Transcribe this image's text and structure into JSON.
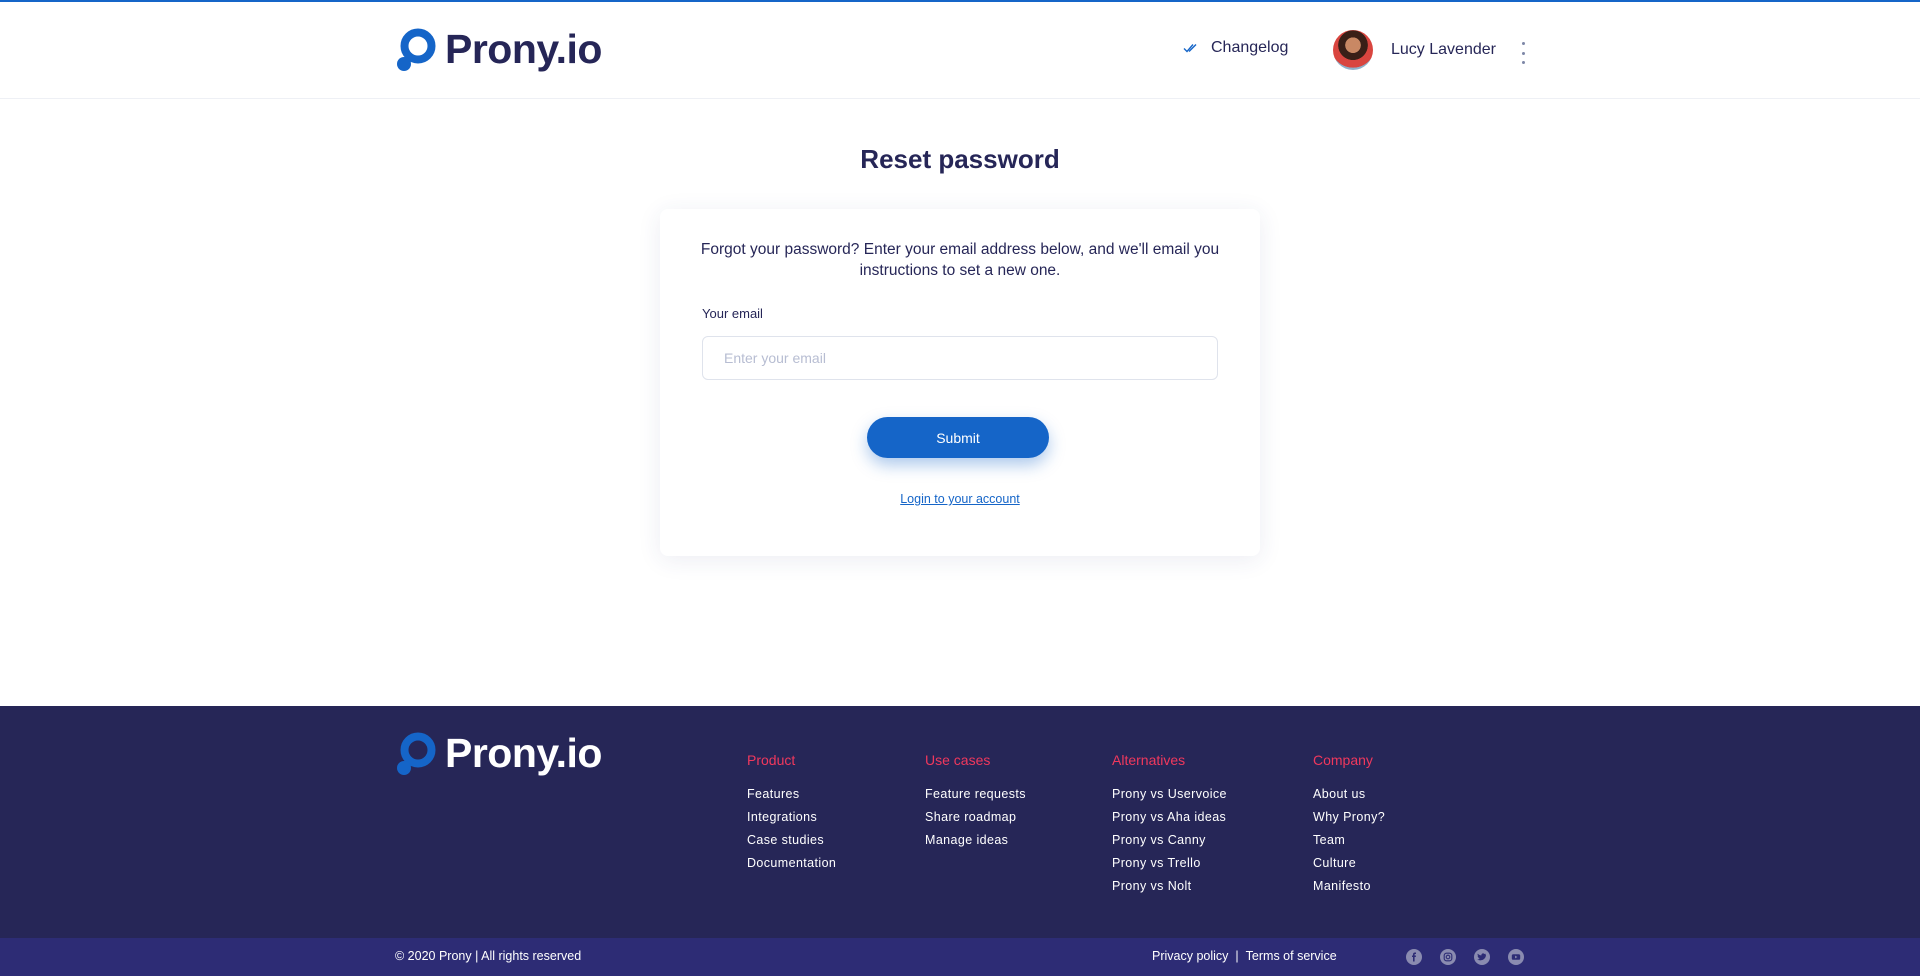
{
  "colors": {
    "primary": "#1565c8",
    "navy": "#262657",
    "footer_bg": "#262657",
    "bottom_bar_bg": "#2d2c75",
    "accent_red": "#f0385d"
  },
  "header": {
    "logo_text": "Prony.io",
    "changelog_label": "Changelog",
    "changelog_icon": "double-check-icon",
    "user_name": "Lucy Lavender",
    "menu_icon": "kebab-menu-icon"
  },
  "main": {
    "title": "Reset password",
    "intro": "Forgot your password? Enter your email address below, and we'll email you instructions to set a new one.",
    "email_label": "Your email",
    "email_placeholder": "Enter your email",
    "email_value": "",
    "submit_label": "Submit",
    "login_link": "Login to your account"
  },
  "footer": {
    "logo_text": "Prony.io",
    "columns": [
      {
        "heading": "Product",
        "links": [
          "Features",
          "Integrations",
          "Case studies",
          "Documentation"
        ]
      },
      {
        "heading": "Use cases",
        "links": [
          "Feature requests",
          "Share roadmap",
          "Manage ideas"
        ]
      },
      {
        "heading": "Alternatives",
        "links": [
          "Prony vs Uservoice",
          "Prony vs Aha ideas",
          "Prony vs Canny",
          "Prony vs Trello",
          "Prony vs Nolt"
        ]
      },
      {
        "heading": "Company",
        "links": [
          "About us",
          "Why Prony?",
          "Team",
          "Culture",
          "Manifesto"
        ]
      }
    ],
    "copyright": "© 2020 Prony  |  All rights reserved",
    "privacy": "Privacy policy",
    "separator": "|",
    "terms": "Terms of service",
    "socials": [
      "facebook-icon",
      "instagram-icon",
      "twitter-icon",
      "youtube-icon"
    ]
  }
}
